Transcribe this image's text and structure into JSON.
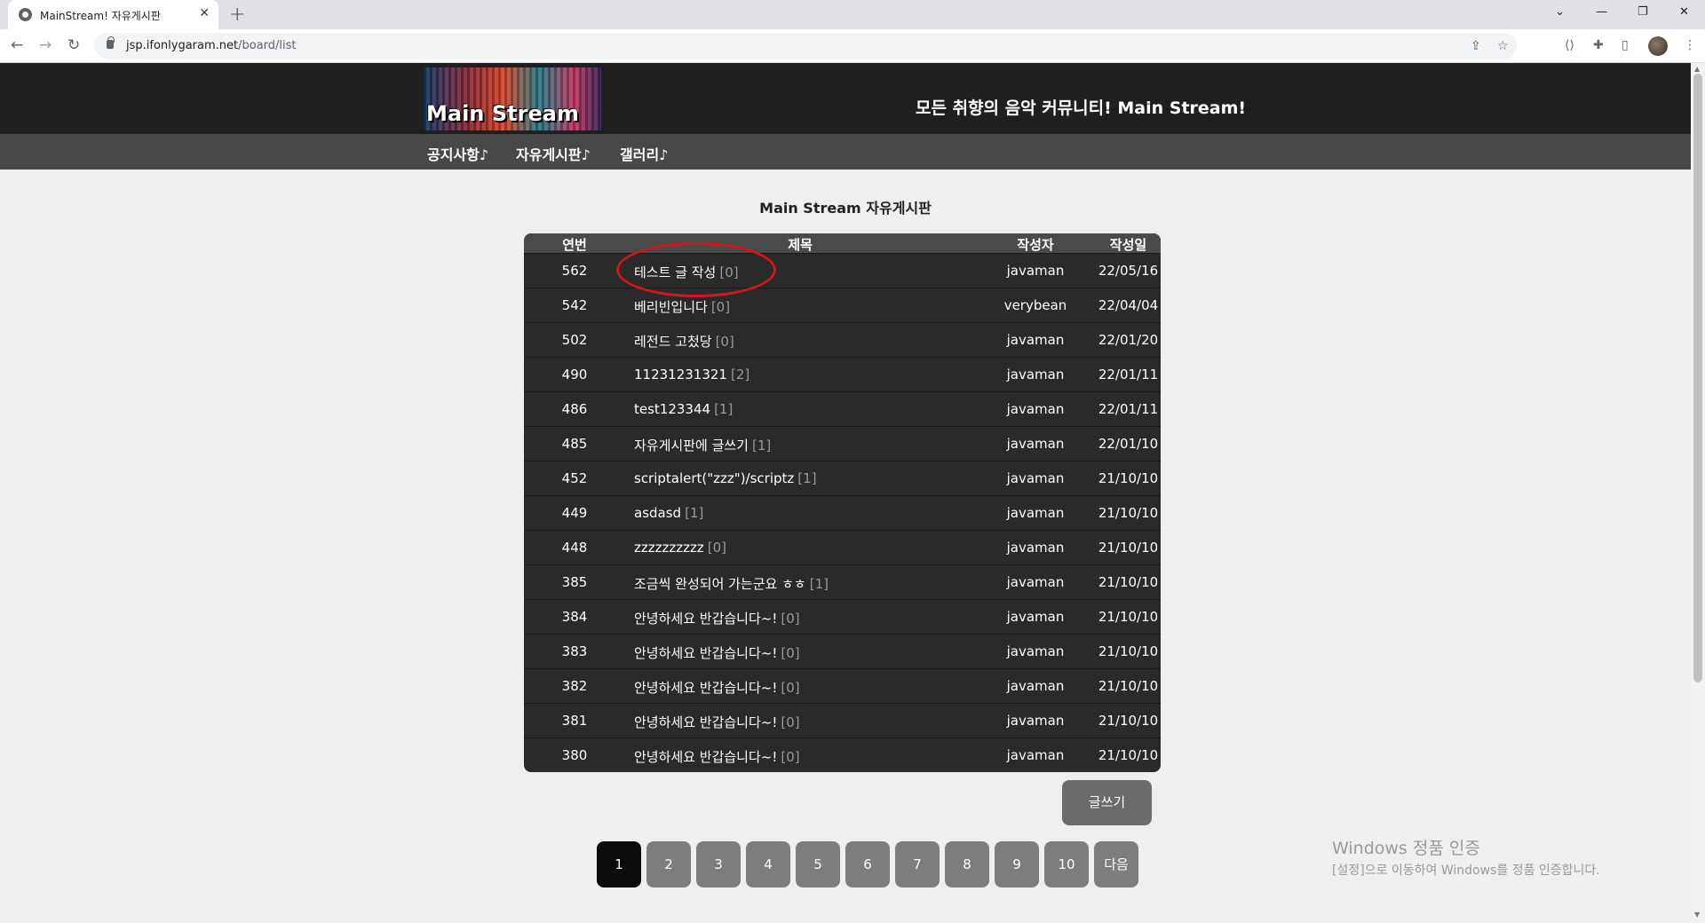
{
  "browser": {
    "tab_title": "MainStream! 자유게시판",
    "tab_close": "✕",
    "new_tab": "+",
    "url_host": "jsp.ifonlygaram.net",
    "url_path": "/board/list"
  },
  "site": {
    "logo_text": "Main Stream",
    "slogan": "모든 취향의 음악 커뮤니티! Main Stream!",
    "menu": [
      "공지사항♪",
      "자유게시판♪",
      "갤러리♪"
    ]
  },
  "board": {
    "title": "Main Stream 자유게시판",
    "columns": {
      "num": "연번",
      "title": "제목",
      "author": "작성자",
      "date": "작성일"
    },
    "rows": [
      {
        "num": "562",
        "title": "테스트 글 작성",
        "replies": "[0]",
        "author": "javaman",
        "date": "22/05/16"
      },
      {
        "num": "542",
        "title": "베리빈입니다",
        "replies": "[0]",
        "author": "verybean",
        "date": "22/04/04"
      },
      {
        "num": "502",
        "title": "레전드 고첬당",
        "replies": "[0]",
        "author": "javaman",
        "date": "22/01/20"
      },
      {
        "num": "490",
        "title": "11231231321",
        "replies": "[2]",
        "author": "javaman",
        "date": "22/01/11"
      },
      {
        "num": "486",
        "title": "test123344",
        "replies": "[1]",
        "author": "javaman",
        "date": "22/01/11"
      },
      {
        "num": "485",
        "title": "자유게시판에 글쓰기",
        "replies": "[1]",
        "author": "javaman",
        "date": "22/01/10"
      },
      {
        "num": "452",
        "title": "scriptalert(\"zzz\")/scriptz",
        "replies": "[1]",
        "author": "javaman",
        "date": "21/10/10"
      },
      {
        "num": "449",
        "title": "asdasd",
        "replies": "[1]",
        "author": "javaman",
        "date": "21/10/10"
      },
      {
        "num": "448",
        "title": "zzzzzzzzzz",
        "replies": "[0]",
        "author": "javaman",
        "date": "21/10/10"
      },
      {
        "num": "385",
        "title": "조금씩 완성되어 가는군요 ㅎㅎ",
        "replies": "[1]",
        "author": "javaman",
        "date": "21/10/10"
      },
      {
        "num": "384",
        "title": "안녕하세요 반갑습니다~!",
        "replies": "[0]",
        "author": "javaman",
        "date": "21/10/10"
      },
      {
        "num": "383",
        "title": "안녕하세요 반갑습니다~!",
        "replies": "[0]",
        "author": "javaman",
        "date": "21/10/10"
      },
      {
        "num": "382",
        "title": "안녕하세요 반갑습니다~!",
        "replies": "[0]",
        "author": "javaman",
        "date": "21/10/10"
      },
      {
        "num": "381",
        "title": "안녕하세요 반갑습니다~!",
        "replies": "[0]",
        "author": "javaman",
        "date": "21/10/10"
      },
      {
        "num": "380",
        "title": "안녕하세요 반갑습니다~!",
        "replies": "[0]",
        "author": "javaman",
        "date": "21/10/10"
      }
    ],
    "write_button": "글쓰기"
  },
  "pagination": {
    "pages": [
      "1",
      "2",
      "3",
      "4",
      "5",
      "6",
      "7",
      "8",
      "9",
      "10"
    ],
    "next": "다음",
    "current": "1"
  },
  "windows_activation": {
    "title": "Windows 정품 인증",
    "subtitle": "[설정]으로 이동하여 Windows를 정품 인증합니다."
  },
  "colors": {
    "header_bg": "#1f1f1f",
    "menu_bg": "#484848",
    "board_bg": "#2a2a2a",
    "highlight_circle": "#d1151e",
    "active_page": "#0b0b0b"
  }
}
